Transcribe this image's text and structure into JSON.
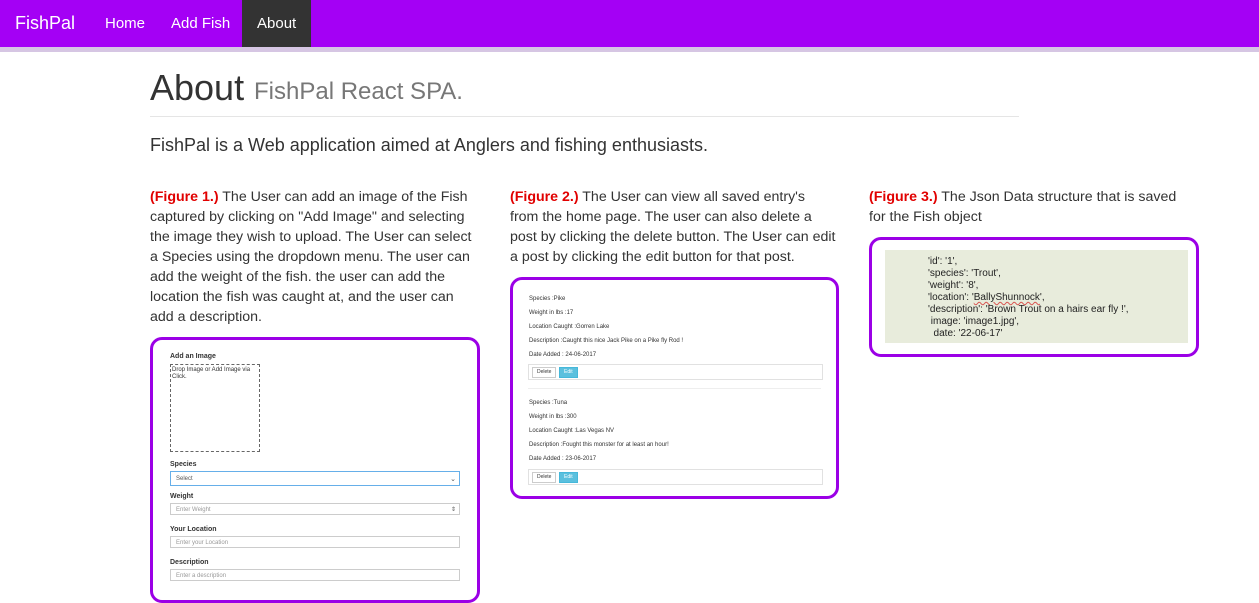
{
  "nav": {
    "brand": "FishPal",
    "links": [
      "Home",
      "Add Fish",
      "About"
    ],
    "active": "About"
  },
  "header": {
    "title": "About",
    "subtitle": "FishPal React SPA."
  },
  "intro": "FishPal is a Web application aimed at Anglers and fishing enthusiasts.",
  "figures": [
    {
      "label": "(Figure 1.)",
      "lines": [
        " The User can add an image of the Fish",
        "captured by clicking on \"Add Image\" and selecting",
        "the image they wish to upload. The User can select",
        "a Species using the dropdown menu. The user can",
        "add the weight of the fish. the user can add the",
        "location the fish was caught at, and the user can",
        "add a description."
      ]
    },
    {
      "label": "(Figure 2.)",
      "lines": [
        " The User can view all saved entry's",
        "from the home page. The user can also delete a",
        "post by clicking the delete button. The User can edit",
        "a post by clicking the edit button for that post."
      ]
    },
    {
      "label": "(Figure 3.)",
      "lines": [
        " The Json Data structure that is saved",
        "for the Fish object"
      ]
    }
  ],
  "fig1_form": {
    "add_image": "Add an Image",
    "drop_text_1": "Drop Image or Add Image via",
    "drop_text_2": "Click.",
    "species_label": "Species",
    "species_value": "Select",
    "weight_label": "Weight",
    "weight_placeholder": "Enter Weight",
    "location_label": "Your Location",
    "location_placeholder": "Enter your Location",
    "description_label": "Description",
    "description_placeholder": "Enter a description"
  },
  "fig2_posts": [
    {
      "species": "Species :Pike",
      "weight": "Weight in lbs :17",
      "location": "Location Caught :Gorren Lake",
      "description": "Description :Caught this nice Jack Pike on a Pike fly Rod !",
      "date": "Date Added : 24-06-2017",
      "delete": "Delete",
      "edit": "Edit"
    },
    {
      "species": "Species :Tuna",
      "weight": "Weight in lbs :300",
      "location": "Location Caught :Las Vegas NV",
      "description": "Description :Fought this monster for at least an hour!",
      "date": "Date Added : 23-06-2017",
      "delete": "Delete",
      "edit": "Edit"
    }
  ],
  "fig3_json": {
    "line1": "'id': '1',",
    "line2": "'species': 'Trout',",
    "line3": "'weight': '8',",
    "line4_prefix": "'location': '",
    "line4_word": "BallyShunnock",
    "line4_suffix": "',",
    "line5": "'description': 'Brown Trout on a hairs ear fly !',",
    "line6": " image: 'image1.jpg',",
    "line7": "  date: '22-06-17'"
  },
  "colors": {
    "navbar": "#a400f5",
    "nav_active": "#333333",
    "frame_border": "#9b00e6",
    "figure_label": "#e10000"
  }
}
